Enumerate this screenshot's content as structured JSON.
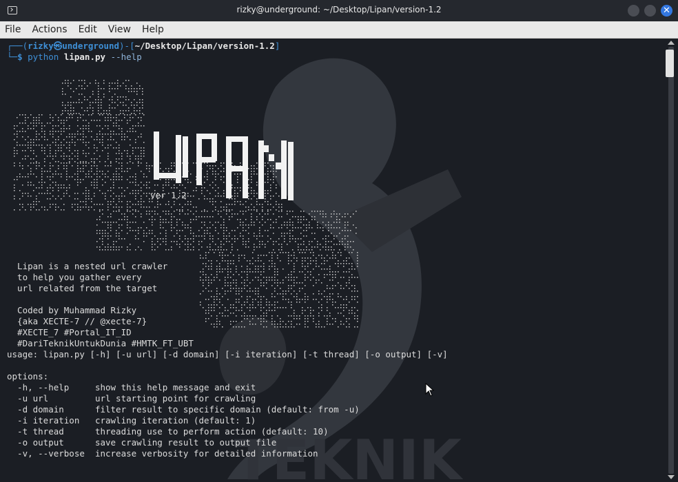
{
  "window": {
    "title": "rizky@underground: ~/Desktop/Lipan/version-1.2",
    "icon": "terminal-icon",
    "close_glyph": "✕"
  },
  "menubar": {
    "items": [
      "File",
      "Actions",
      "Edit",
      "View",
      "Help"
    ]
  },
  "prompt": {
    "open": "┌──(",
    "user": "rizky㉿underground",
    "mid": ")-[",
    "dir": "~/Desktop/Lipan/version-1.2",
    "close": "]",
    "line2_start": "└─",
    "dollar": "$",
    "command": "python",
    "file": "lipan.py",
    "arg": "--help"
  },
  "banner": {
    "logo_text": "LIPAN",
    "version": "ver 1.2"
  },
  "description": [
    "Lipan is a nested url crawler",
    "to help you gather every",
    "url related from the target",
    "",
    "Coded by Muhammad Rizky",
    "{aka XECTE-7 // @xecte-7}",
    "#XECTE_7 #Portal_IT_ID",
    "#DariTeknikUntukDunia #HMTK_FT_UBT"
  ],
  "usage": "usage: lipan.py [-h] [-u url] [-d domain] [-i iteration] [-t thread] [-o output] [-v]",
  "options_header": "options:",
  "options": [
    {
      "flag": "-h, --help",
      "desc": "show this help message and exit"
    },
    {
      "flag": "-u url",
      "desc": "url starting point for crawling"
    },
    {
      "flag": "-d domain",
      "desc": "filter result to specific domain (default: from -u)"
    },
    {
      "flag": "-i iteration",
      "desc": "crawling iteration (default: 1)"
    },
    {
      "flag": "-t thread",
      "desc": "threading use to perform action (default: 10)"
    },
    {
      "flag": "-o output",
      "desc": "save crawling result to output file"
    },
    {
      "flag": "-v, --verbose",
      "desc": "increase verbosity for detailed information"
    }
  ],
  "watermark_text": "TEKNIK",
  "colors": {
    "background": "#1b1e24",
    "prompt_blue": "#3e8fd6",
    "text": "#dcdcdc"
  }
}
